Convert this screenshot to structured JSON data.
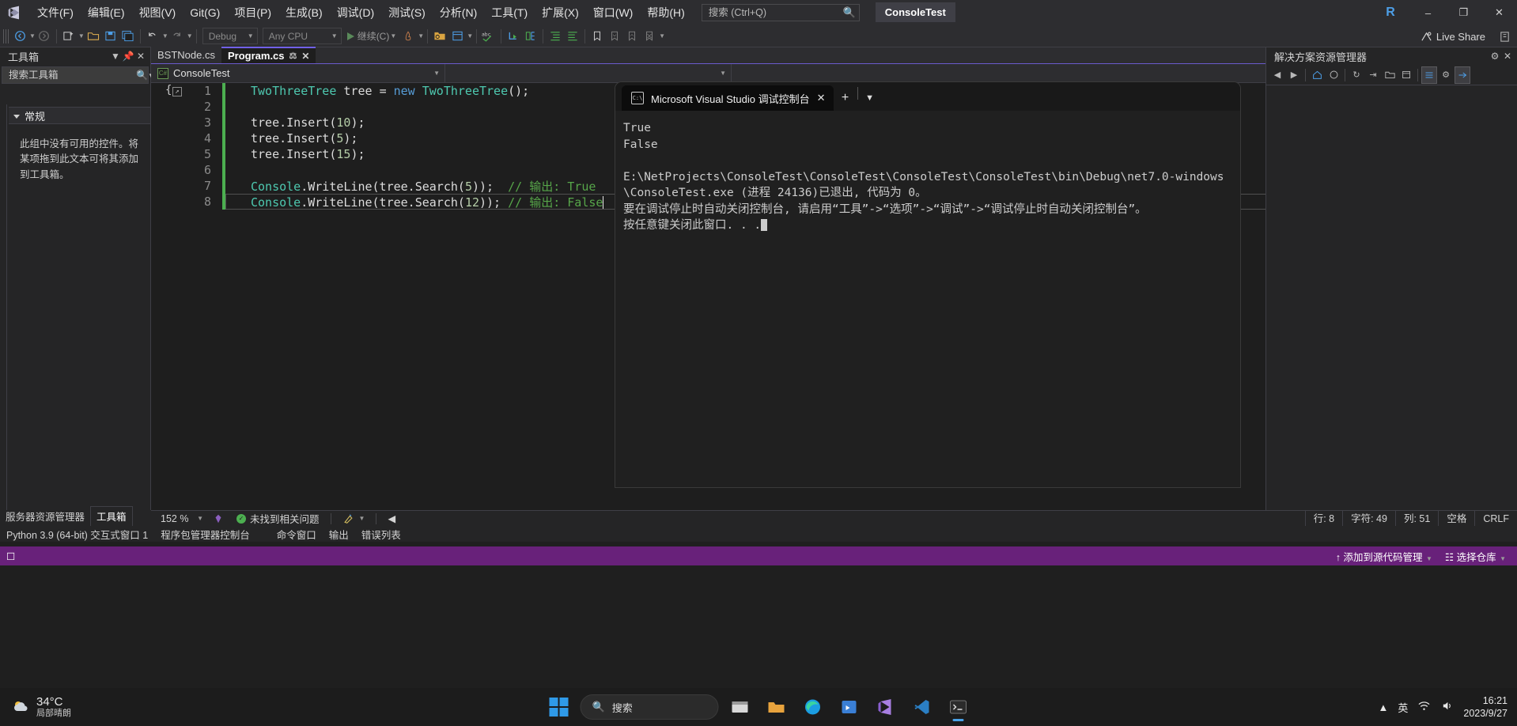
{
  "titlebar": {
    "logo_icon": "visual-studio-logo",
    "menus": [
      {
        "label": "文件(F)"
      },
      {
        "label": "编辑(E)"
      },
      {
        "label": "视图(V)"
      },
      {
        "label": "Git(G)"
      },
      {
        "label": "项目(P)"
      },
      {
        "label": "生成(B)"
      },
      {
        "label": "调试(D)"
      },
      {
        "label": "测试(S)"
      },
      {
        "label": "分析(N)"
      },
      {
        "label": "工具(T)"
      },
      {
        "label": "扩展(X)"
      },
      {
        "label": "窗口(W)"
      },
      {
        "label": "帮助(H)"
      }
    ],
    "search_placeholder": "搜索 (Ctrl+Q)",
    "search_value": "",
    "solution_name": "ConsoleTest",
    "account_initial": "R",
    "minimize": "–",
    "maximize": "❐",
    "close": "✕"
  },
  "toolbar": {
    "nav_back": "←",
    "nav_forward": "→",
    "new_item": "⊞",
    "open": "▱",
    "save": "▤",
    "save_all": "▥",
    "undo": "↶",
    "redo": "↷",
    "config_value": "Debug",
    "platform_value": "Any CPU",
    "run_label": "继续(C)",
    "hot_reload": "ὒ5",
    "live_share_label": "Live Share"
  },
  "toolbox": {
    "title": "工具箱",
    "search_placeholder": "搜索工具箱",
    "search_value": "",
    "group_label": "常规",
    "empty_text": "此组中没有可用的控件。将某项拖到此文本可将其添加到工具箱。",
    "pin_icon": "pin-icon",
    "close_icon": "close-icon",
    "tabs": [
      {
        "label": "服务器资源管理器",
        "active": false
      },
      {
        "label": "工具箱",
        "active": true
      }
    ]
  },
  "editor": {
    "tabs": [
      {
        "label": "BSTNode.cs",
        "active": false
      },
      {
        "label": "Program.cs",
        "active": true
      }
    ],
    "nav_project": "ConsoleTest",
    "nav_member": "",
    "lines": [
      {
        "num": "1",
        "modified": true,
        "tokens": [
          {
            "t": "TwoThreeTree",
            "c": "tok-type"
          },
          {
            "t": " tree ",
            "c": "tok-id"
          },
          {
            "t": "= ",
            "c": "tok-punct"
          },
          {
            "t": "new ",
            "c": "tok-kw"
          },
          {
            "t": "TwoThreeTree",
            "c": "tok-type"
          },
          {
            "t": "();",
            "c": "tok-punct"
          }
        ]
      },
      {
        "num": "2",
        "modified": true,
        "tokens": []
      },
      {
        "num": "3",
        "modified": true,
        "tokens": [
          {
            "t": "tree.",
            "c": "tok-id"
          },
          {
            "t": "Insert",
            "c": "tok-id"
          },
          {
            "t": "(",
            "c": "tok-punct"
          },
          {
            "t": "10",
            "c": "tok-num"
          },
          {
            "t": ");",
            "c": "tok-punct"
          }
        ]
      },
      {
        "num": "4",
        "modified": true,
        "tokens": [
          {
            "t": "tree.",
            "c": "tok-id"
          },
          {
            "t": "Insert",
            "c": "tok-id"
          },
          {
            "t": "(",
            "c": "tok-punct"
          },
          {
            "t": "5",
            "c": "tok-num"
          },
          {
            "t": ");",
            "c": "tok-punct"
          }
        ]
      },
      {
        "num": "5",
        "modified": true,
        "tokens": [
          {
            "t": "tree.",
            "c": "tok-id"
          },
          {
            "t": "Insert",
            "c": "tok-id"
          },
          {
            "t": "(",
            "c": "tok-punct"
          },
          {
            "t": "15",
            "c": "tok-num"
          },
          {
            "t": ");",
            "c": "tok-punct"
          }
        ]
      },
      {
        "num": "6",
        "modified": true,
        "tokens": []
      },
      {
        "num": "7",
        "modified": true,
        "tokens": [
          {
            "t": "Console",
            "c": "tok-type"
          },
          {
            "t": ".WriteLine(tree.",
            "c": "tok-id"
          },
          {
            "t": "Search",
            "c": "tok-id"
          },
          {
            "t": "(",
            "c": "tok-punct"
          },
          {
            "t": "5",
            "c": "tok-num"
          },
          {
            "t": "));  ",
            "c": "tok-punct"
          },
          {
            "t": "// 输出: True",
            "c": "tok-comment"
          }
        ]
      },
      {
        "num": "8",
        "modified": true,
        "current": true,
        "tokens": [
          {
            "t": "Console",
            "c": "tok-type"
          },
          {
            "t": ".WriteLine(tree.",
            "c": "tok-id"
          },
          {
            "t": "Search",
            "c": "tok-id"
          },
          {
            "t": "(",
            "c": "tok-punct"
          },
          {
            "t": "12",
            "c": "tok-num"
          },
          {
            "t": ")); ",
            "c": "tok-punct"
          },
          {
            "t": "// 输出: False",
            "c": "tok-comment"
          }
        ]
      }
    ],
    "open_brace": "{",
    "statusbar": {
      "zoom": "152 %",
      "issues": "未找到相关问题",
      "line_label": "行: 8",
      "char_label": "字符: 49",
      "col_label": "列: 51",
      "spaces_label": "空格",
      "eol_label": "CRLF"
    }
  },
  "solution_explorer": {
    "title": "解决方案资源管理器",
    "gear_icon": "gear-icon",
    "close_icon": "close-icon"
  },
  "console_window": {
    "tab_title": "Microsoft Visual Studio 调试控制台",
    "tab_icon": "terminal-icon",
    "close_icon": "close-icon",
    "new_tab_icon": "plus-icon",
    "dropdown_icon": "chevron-down-icon",
    "output_lines": [
      "True",
      "False",
      "",
      "E:\\NetProjects\\ConsoleTest\\ConsoleTest\\ConsoleTest\\ConsoleTest\\bin\\Debug\\net7.0-windows\\ConsoleTest.exe (进程 24136)已退出, 代码为 0。",
      "要在调试停止时自动关闭控制台, 请启用“工具”->“选项”->“调试”->“调试停止时自动关闭控制台”。",
      "按任意键关闭此窗口. . ."
    ]
  },
  "bottom_dock_tabs": [
    {
      "label": "命令窗口"
    },
    {
      "label": "输出"
    },
    {
      "label": "错误列表"
    }
  ],
  "vs_statusbar": {
    "left_items": [
      "Python 3.9 (64-bit) 交互式窗口 1",
      "程序包管理器控制台"
    ],
    "add_to_source_control": "添加到源代码管理",
    "select_repo": "选择仓库",
    "upload_icon": "upload-icon",
    "repo_icon": "repository-icon"
  },
  "taskbar": {
    "weather_temp": "34°C",
    "weather_desc": "局部晴朗",
    "start_icon": "windows-start-icon",
    "search_placeholder": "搜索",
    "apps": [
      {
        "name": "file-explorer-icon",
        "color": "#e8b44a"
      },
      {
        "name": "folder-icon",
        "color": "#e8a33d"
      },
      {
        "name": "edge-icon",
        "color": "#1b9de2"
      },
      {
        "name": "store-icon",
        "color": "#3a7fd5"
      },
      {
        "name": "visual-studio-icon",
        "color": "#6c3fb5"
      },
      {
        "name": "vscode-icon",
        "color": "#2b7fc4"
      },
      {
        "name": "terminal-icon",
        "color": "#1f1f1f",
        "active": true
      }
    ],
    "tray_chevron": "∧",
    "lang": "英",
    "wifi_icon": "wifi-icon",
    "volume_icon": "volume-icon",
    "time": "16:21",
    "date": "2023/9/27"
  },
  "colors": {
    "accent_purple": "#68217a",
    "tab_accent": "#7160e8",
    "modified_bar": "#4caf50",
    "comment_green": "#57a64a",
    "type_teal": "#4ec9b0",
    "keyword_blue": "#569cd6"
  }
}
